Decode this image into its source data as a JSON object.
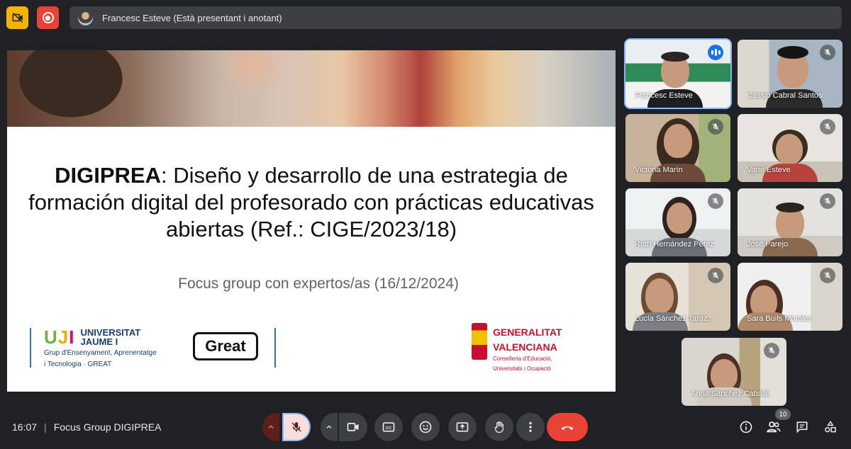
{
  "top": {
    "presenter_text": "Francesc Esteve (Està presentant i anotant)"
  },
  "slide": {
    "title_bold": "DIGIPREA",
    "title_rest": ": Diseño y desarrollo de una estrategia de formación digital del profesorado con prácticas educativas abiertas (Ref.: CIGE/2023/18)",
    "subtitle": "Focus group con expertos/as (16/12/2024)",
    "logos": {
      "uji_letters": [
        "U",
        "J",
        "I"
      ],
      "uji_name_1": "UNIVERSITAT",
      "uji_name_2": "JAUME I",
      "uji_desc_1": "Grup d'Ensenyament, Aprenentatge",
      "uji_desc_2": "i Tecnologia · GREAT",
      "great": "Great",
      "gva_name_1": "GENERALITAT",
      "gva_name_2": "VALENCIANA",
      "gva_desc_1": "Conselleria d'Educació,",
      "gva_desc_2": "Universitats i Ocupació"
    }
  },
  "participants": [
    {
      "name": "Francesc Esteve",
      "status": "speaking"
    },
    {
      "name": "Cássio Cabral Santos",
      "status": "muted"
    },
    {
      "name": "Victoria Marín",
      "status": "muted"
    },
    {
      "name": "Vane Esteve",
      "status": "muted"
    },
    {
      "name": "Ruth Hernández Pérez",
      "status": "muted"
    },
    {
      "name": "José Parejo",
      "status": "muted"
    },
    {
      "name": "Lucía Sánchez Taraz...",
      "status": "muted"
    },
    {
      "name": "Sara Buils Morales",
      "status": "muted"
    },
    {
      "name": "Anna Sánchez Caballé",
      "status": "muted"
    }
  ],
  "bottom": {
    "time": "16:07",
    "separator": "|",
    "meeting_name": "Focus Group DIGIPREA",
    "participant_count": "10"
  },
  "colors": {
    "background": "#202124",
    "control": "#3c4043",
    "hangup": "#ea4335",
    "accent_blue": "#8ab4f8",
    "camera_chip": "#f4b400",
    "record_chip": "#ea4335"
  }
}
